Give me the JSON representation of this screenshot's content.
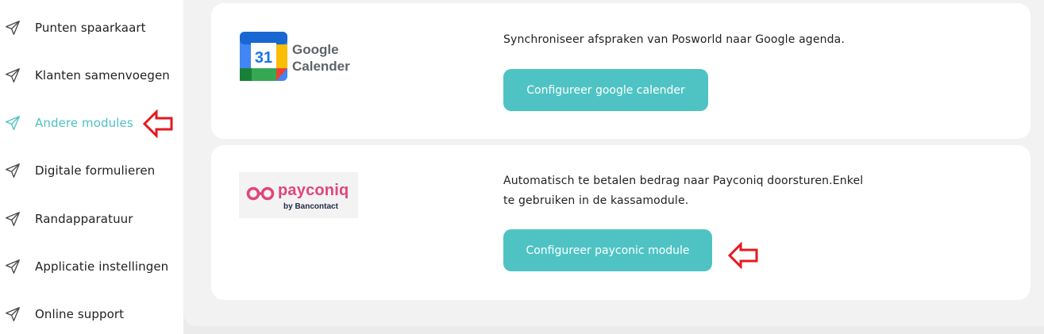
{
  "sidebar": {
    "items": [
      {
        "label": "Punten spaarkaart",
        "icon": "send-icon",
        "active": false
      },
      {
        "label": "Klanten samenvoegen",
        "icon": "send-icon",
        "active": false
      },
      {
        "label": "Andere modules",
        "icon": "send-icon",
        "active": true
      },
      {
        "label": "Digitale formulieren",
        "icon": "send-icon",
        "active": false
      },
      {
        "label": "Randapparatuur",
        "icon": "send-icon",
        "active": false
      },
      {
        "label": "Applicatie instellingen",
        "icon": "send-icon",
        "active": false
      },
      {
        "label": "Online support",
        "icon": "send-icon",
        "active": false
      }
    ]
  },
  "modules": [
    {
      "logo": {
        "badge_number": "31",
        "line1": "Google",
        "line2": "Calender"
      },
      "description": "Synchroniseer afspraken van Posworld naar Google agenda.",
      "button_label": "Configureer google calender"
    },
    {
      "logo": {
        "word": "payconiq",
        "sub": "by Bancontact"
      },
      "description_line1": "Automatisch te betalen bedrag naar Payconiq doorsturen.Enkel",
      "description_line2": "te gebruiken in de kassamodule.",
      "button_label": "Configureer payconic module"
    }
  ],
  "colors": {
    "accent": "#4fc3c3",
    "active_text": "#4fc1c2",
    "annotation_arrow": "#e3191f",
    "payconiq_pink": "#e0457a"
  }
}
